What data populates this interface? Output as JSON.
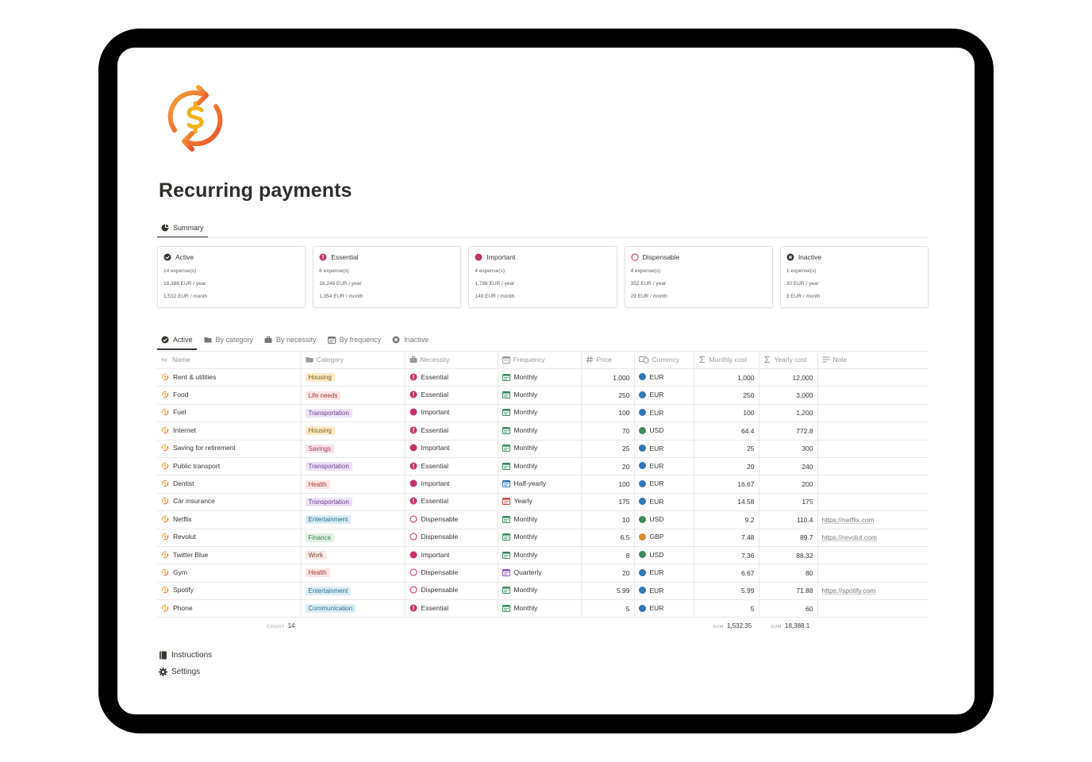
{
  "page": {
    "title": "Recurring payments"
  },
  "summary_tabs": [
    {
      "label": "Summary",
      "icon": "pie-chart-icon",
      "active": true
    }
  ],
  "cards": [
    {
      "title": "Active",
      "icon": "check-circle-icon",
      "color": "#37352f",
      "count": "14 expense(s)",
      "yearly": "18,388 EUR / year",
      "monthly": "1,532 EUR / month"
    },
    {
      "title": "Essential",
      "icon": "exclamation-circle-icon",
      "color": "#c4336b",
      "count": "6 expense(s)",
      "yearly": "16,248 EUR / year",
      "monthly": "1,354 EUR / month"
    },
    {
      "title": "Important",
      "icon": "filled-circle-icon",
      "color": "#c4336b",
      "count": "4 expense(s)",
      "yearly": "1,788 EUR / year",
      "monthly": "149 EUR / month"
    },
    {
      "title": "Dispensable",
      "icon": "empty-circle-icon",
      "color": "#c4336b",
      "count": "4 expense(s)",
      "yearly": "352 EUR / year",
      "monthly": "29 EUR / month"
    },
    {
      "title": "Inactive",
      "icon": "x-circle-icon",
      "color": "#37352f",
      "count": "1 expense(s)",
      "yearly": "30 EUR / year",
      "monthly": "3 EUR / month"
    }
  ],
  "view_tabs": [
    {
      "label": "Active",
      "icon": "check-circle-icon",
      "active": true
    },
    {
      "label": "By category",
      "icon": "folder-icon",
      "active": false
    },
    {
      "label": "By necessity",
      "icon": "briefcase-icon",
      "active": false
    },
    {
      "label": "By frequency",
      "icon": "calendar-icon",
      "active": false
    },
    {
      "label": "Inactive",
      "icon": "x-circle-icon",
      "active": false
    }
  ],
  "columns": [
    {
      "label": "Name",
      "icon": "text-icon"
    },
    {
      "label": "Category",
      "icon": "folder-icon"
    },
    {
      "label": "Necessity",
      "icon": "briefcase-icon"
    },
    {
      "label": "Frequency",
      "icon": "calendar-icon"
    },
    {
      "label": "Price",
      "icon": "hash-icon"
    },
    {
      "label": "Currency",
      "icon": "currency-icon"
    },
    {
      "label": "Monthly cost",
      "icon": "sigma-icon"
    },
    {
      "label": "Yearly cost",
      "icon": "sigma-icon"
    },
    {
      "label": "Note",
      "icon": "lines-icon"
    }
  ],
  "category_colors": {
    "Housing": {
      "bg": "#fbecc8",
      "fg": "#7a5a1a"
    },
    "Life needs": {
      "bg": "#fbe4e4",
      "fg": "#a33b3b"
    },
    "Transportation": {
      "bg": "#ece3f4",
      "fg": "#6a3f8a"
    },
    "Savings": {
      "bg": "#f6e3ea",
      "fg": "#9b3f61"
    },
    "Health": {
      "bg": "#fbe4e4",
      "fg": "#a33b3b"
    },
    "Entertainment": {
      "bg": "#dcedf4",
      "fg": "#2b6a87"
    },
    "Finance": {
      "bg": "#e1f0e5",
      "fg": "#3c7a4b"
    },
    "Work": {
      "bg": "#f4e9e4",
      "fg": "#7a4a3a"
    },
    "Communication": {
      "bg": "#dcedf4",
      "fg": "#2b6a87"
    }
  },
  "currency_colors": {
    "EUR": "#2f78b4",
    "USD": "#3f8b5f",
    "GBP": "#d98c2a"
  },
  "frequency_colors": {
    "Monthly": "#3f8b5f",
    "Half-yearly": "#2f78b4",
    "Yearly": "#d44c47",
    "Quarterly": "#8e5ab8"
  },
  "accent_color": "#c4336b",
  "rows": [
    {
      "name": "Rent & utilities",
      "category": "Housing",
      "necessity": "Essential",
      "frequency": "Monthly",
      "price": "1,000",
      "currency": "EUR",
      "monthly": "1,000",
      "yearly": "12,000",
      "note": ""
    },
    {
      "name": "Food",
      "category": "Life needs",
      "necessity": "Essential",
      "frequency": "Monthly",
      "price": "250",
      "currency": "EUR",
      "monthly": "250",
      "yearly": "3,000",
      "note": ""
    },
    {
      "name": "Fuel",
      "category": "Transportation",
      "necessity": "Important",
      "frequency": "Monthly",
      "price": "100",
      "currency": "EUR",
      "monthly": "100",
      "yearly": "1,200",
      "note": ""
    },
    {
      "name": "Internet",
      "category": "Housing",
      "necessity": "Essential",
      "frequency": "Monthly",
      "price": "70",
      "currency": "USD",
      "monthly": "64.4",
      "yearly": "772.8",
      "note": ""
    },
    {
      "name": "Saving for retirement",
      "category": "Savings",
      "necessity": "Important",
      "frequency": "Monthly",
      "price": "25",
      "currency": "EUR",
      "monthly": "25",
      "yearly": "300",
      "note": ""
    },
    {
      "name": "Public transport",
      "category": "Transportation",
      "necessity": "Essential",
      "frequency": "Monthly",
      "price": "20",
      "currency": "EUR",
      "monthly": "20",
      "yearly": "240",
      "note": ""
    },
    {
      "name": "Dentist",
      "category": "Health",
      "necessity": "Important",
      "frequency": "Half-yearly",
      "price": "100",
      "currency": "EUR",
      "monthly": "16.67",
      "yearly": "200",
      "note": ""
    },
    {
      "name": "Car insurance",
      "category": "Transportation",
      "necessity": "Essential",
      "frequency": "Yearly",
      "price": "175",
      "currency": "EUR",
      "monthly": "14.58",
      "yearly": "175",
      "note": ""
    },
    {
      "name": "Netflix",
      "category": "Entertainment",
      "necessity": "Dispensable",
      "frequency": "Monthly",
      "price": "10",
      "currency": "USD",
      "monthly": "9.2",
      "yearly": "110.4",
      "note": "https://netflix.com"
    },
    {
      "name": "Revolut",
      "category": "Finance",
      "necessity": "Dispensable",
      "frequency": "Monthly",
      "price": "6.5",
      "currency": "GBP",
      "monthly": "7.48",
      "yearly": "89.7",
      "note": "https://revolut.com"
    },
    {
      "name": "Twitter Blue",
      "category": "Work",
      "necessity": "Important",
      "frequency": "Monthly",
      "price": "8",
      "currency": "USD",
      "monthly": "7.36",
      "yearly": "88.32",
      "note": ""
    },
    {
      "name": "Gym",
      "category": "Health",
      "necessity": "Dispensable",
      "frequency": "Quarterly",
      "price": "20",
      "currency": "EUR",
      "monthly": "6.67",
      "yearly": "80",
      "note": ""
    },
    {
      "name": "Spotify",
      "category": "Entertainment",
      "necessity": "Dispensable",
      "frequency": "Monthly",
      "price": "5.99",
      "currency": "EUR",
      "monthly": "5.99",
      "yearly": "71.88",
      "note": "https://spotify.com"
    },
    {
      "name": "Phone",
      "category": "Communication",
      "necessity": "Essential",
      "frequency": "Monthly",
      "price": "5",
      "currency": "EUR",
      "monthly": "5",
      "yearly": "60",
      "note": ""
    }
  ],
  "footer": {
    "count_label": "COUNT",
    "count_value": "14",
    "monthly_label": "SUM",
    "monthly_value": "1,532.35",
    "yearly_label": "SUM",
    "yearly_value": "18,388.1"
  },
  "links": [
    {
      "label": "Instructions",
      "icon": "book-icon"
    },
    {
      "label": "Settings",
      "icon": "gear-icon"
    }
  ]
}
